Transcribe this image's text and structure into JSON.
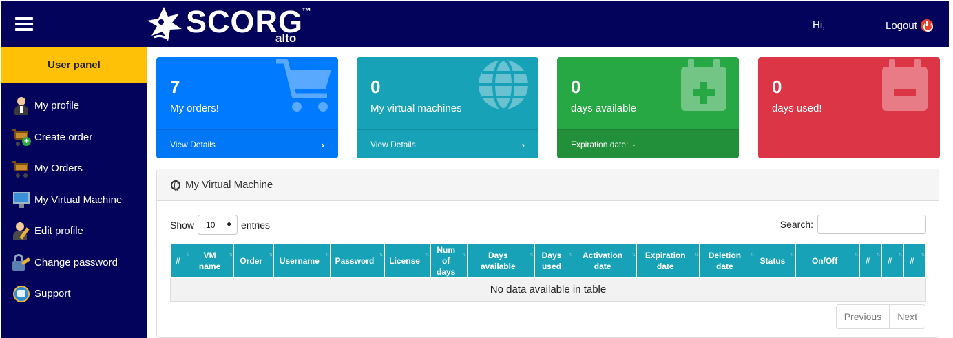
{
  "header": {
    "brand": "SCORG",
    "brand_tm": "™",
    "brand_sub": "alto",
    "greeting": "Hi,",
    "logout": "Logout",
    "colors": {
      "topbar": "#03035c",
      "logout_icon": "#e8412c"
    }
  },
  "sidebar": {
    "title": "User panel",
    "items": [
      {
        "label": "My profile",
        "icon": "user-profile-icon"
      },
      {
        "label": "Create order",
        "icon": "cart-add-icon"
      },
      {
        "label": "My Orders",
        "icon": "cart-icon"
      },
      {
        "label": "My Virtual Machine",
        "icon": "monitor-icon"
      },
      {
        "label": "Edit profile",
        "icon": "user-edit-icon"
      },
      {
        "label": "Change password",
        "icon": "lock-key-icon"
      },
      {
        "label": "Support",
        "icon": "support-icon"
      }
    ]
  },
  "cards": [
    {
      "value": "7",
      "label": "My orders!",
      "footer": "View Details",
      "color": "#007bff",
      "icon": "shopping-cart-icon"
    },
    {
      "value": "0",
      "label": "My virtual machines",
      "footer": "View Details",
      "color": "#17a2b8",
      "icon": "globe-icon"
    },
    {
      "value": "0",
      "label": "days available",
      "footer": "Expiration date:",
      "footer_value": "-",
      "color": "#28a745",
      "icon": "calendar-plus-icon"
    },
    {
      "value": "0",
      "label": "days used!",
      "color": "#dc3545",
      "icon": "calendar-minus-icon"
    }
  ],
  "vm_panel": {
    "title": "My Virtual Machine",
    "show_label": "Show",
    "entries_value": "10",
    "entries_label": "entries",
    "search_label": "Search:",
    "search_value": "",
    "columns": [
      "#",
      "VM name",
      "Order",
      "Username",
      "Password",
      "License",
      "Num of days",
      "Days available",
      "Days used",
      "Activation date",
      "Expiration date",
      "Deletion date",
      "Status",
      "On/Off",
      "#",
      "#",
      "#"
    ],
    "empty_message": "No data available in table",
    "pager": {
      "previous": "Previous",
      "next": "Next"
    }
  }
}
